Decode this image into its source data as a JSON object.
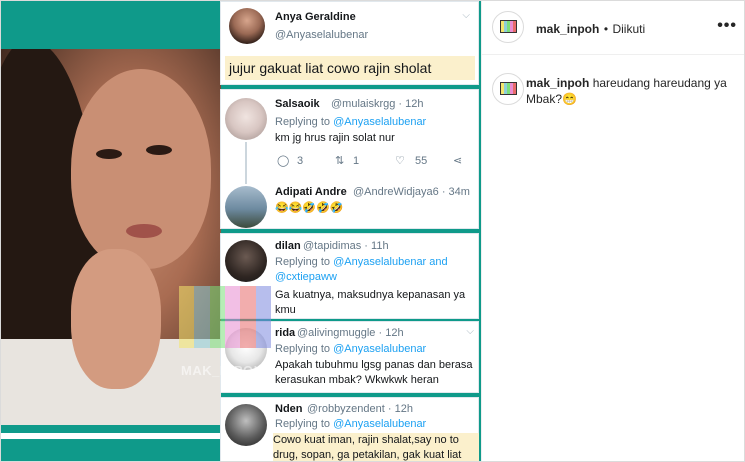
{
  "header": {
    "username": "mak_inpoh",
    "separator": "•",
    "follow_status": "Diikuti",
    "menu": "•••"
  },
  "caption": {
    "username": "mak_inpoh",
    "text": "hareudang hareudang ya Mbak?",
    "emoji": "😁"
  },
  "watermark": "MAK_INPOH",
  "tweets": {
    "main": {
      "name": "Anya Geraldine",
      "handle": "@Anyaselalubenar",
      "text": "jujur gakuat liat cowo rajin sholat"
    },
    "reply1": {
      "name": "Salsaoik",
      "handle": "@mulaiskrgg · 12h",
      "replying_prefix": "Replying to",
      "replying_to": "@Anyaselalubenar",
      "text": "km jg hrus rajin solat nur",
      "reply_count": "3",
      "retweet_count": "1",
      "like_count": "55"
    },
    "reply2": {
      "name": "Adipati Andre",
      "handle": "@AndreWidjaya6 · 34m",
      "text": "😂😂🤣🤣🤣"
    },
    "reply3": {
      "name": "dilan",
      "handle": "@tapidimas · 11h",
      "replying_prefix": "Replying to",
      "replying_to": "@Anyaselalubenar and",
      "replying_to2": "@cxtiepaww",
      "text": "Ga kuatnya, maksudnya kepanasan ya kmu"
    },
    "reply4": {
      "name": "rida",
      "handle": "@alivingmuggle · 12h",
      "replying_prefix": "Replying to",
      "replying_to": "@Anyaselalubenar",
      "text": "Apakah tubuhmu lgsg panas dan berasa kerasukan mbak? Wkwkwk heran"
    },
    "reply5": {
      "name": "Nden",
      "handle": "@robbyzendent · 12h",
      "replying_prefix": "Replying to",
      "replying_to": "@Anyaselalubenar",
      "text": "Cowo kuat iman, rajin shalat,say no to drug, sopan, ga petakilan, gak kuat liat"
    }
  },
  "colors": {
    "teal": "#0f9a8a",
    "twitter_blue": "#1da1f2",
    "highlight": "#fbf0cc"
  }
}
